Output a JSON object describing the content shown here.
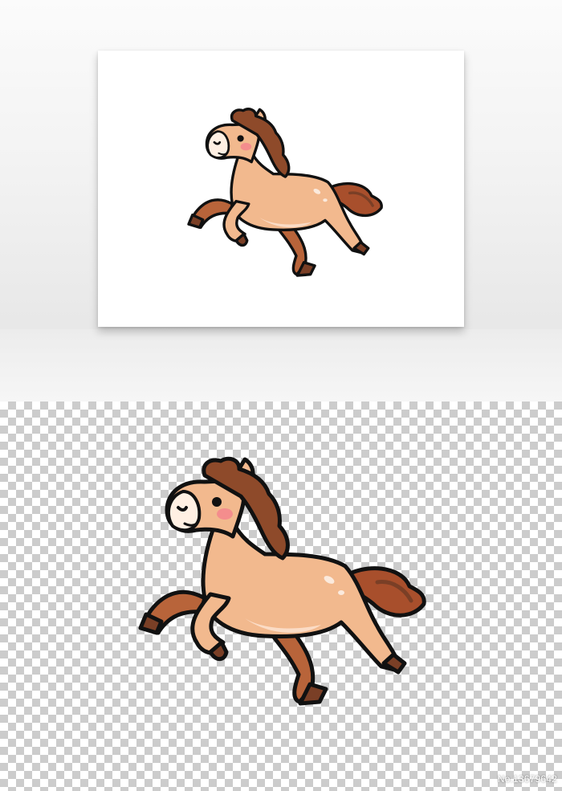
{
  "image_id_label": "No.13679642",
  "colors": {
    "body": "#F2B98E",
    "mane": "#8E4A2A",
    "leg_dark": "#B8643A",
    "hoof": "#7A3F26",
    "belly": "#FBDCC6",
    "muzzle": "#FFF0E3",
    "blush": "#F48D8D",
    "outline": "#111111"
  }
}
